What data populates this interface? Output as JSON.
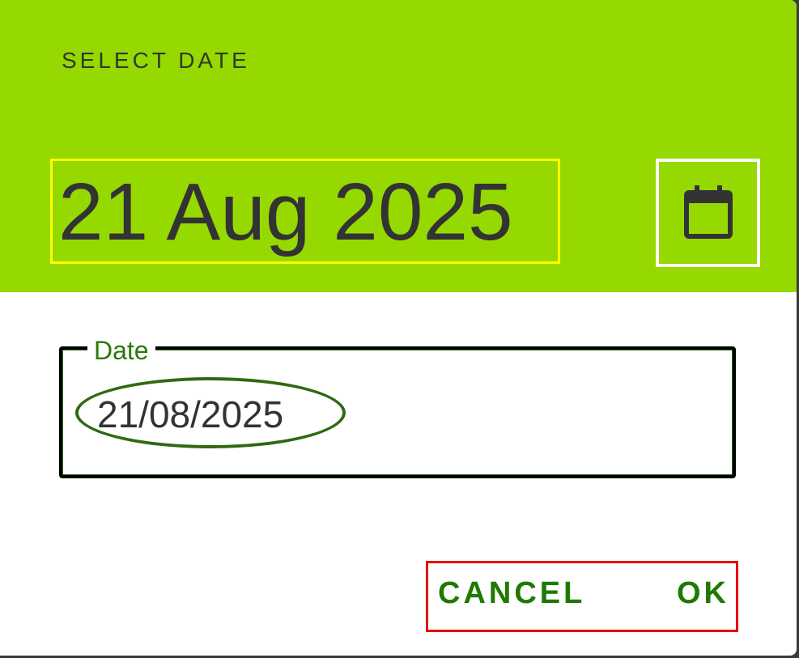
{
  "dialog": {
    "title": "SELECT DATE",
    "selected_date_display": "21 Aug 2025",
    "toggle_icon": "calendar-icon"
  },
  "date_input": {
    "label": "Date",
    "value": "21/08/2025"
  },
  "actions": {
    "cancel_label": "CANCEL",
    "ok_label": "OK"
  },
  "colors": {
    "header_background": "#96d900",
    "accent_text": "#1e7a00",
    "surface": "#ffffff"
  }
}
